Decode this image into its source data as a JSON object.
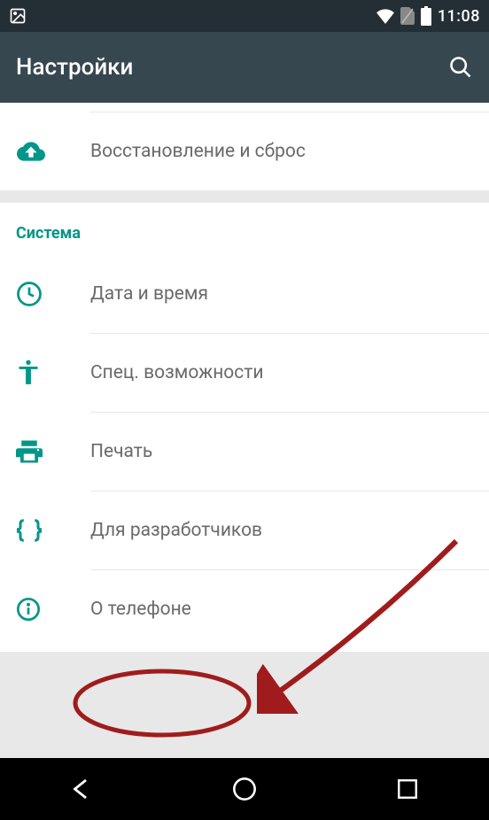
{
  "statusbar": {
    "time": "11:08"
  },
  "appbar": {
    "title": "Настройки"
  },
  "section1": {
    "item0": {
      "label": "Восстановление и сброс"
    }
  },
  "section2": {
    "header": "Система",
    "item0": {
      "label": "Дата и время"
    },
    "item1": {
      "label": "Спец. возможности"
    },
    "item2": {
      "label": "Печать"
    },
    "item3": {
      "label": "Для разработчиков"
    },
    "item4": {
      "label": "О телефоне"
    }
  }
}
